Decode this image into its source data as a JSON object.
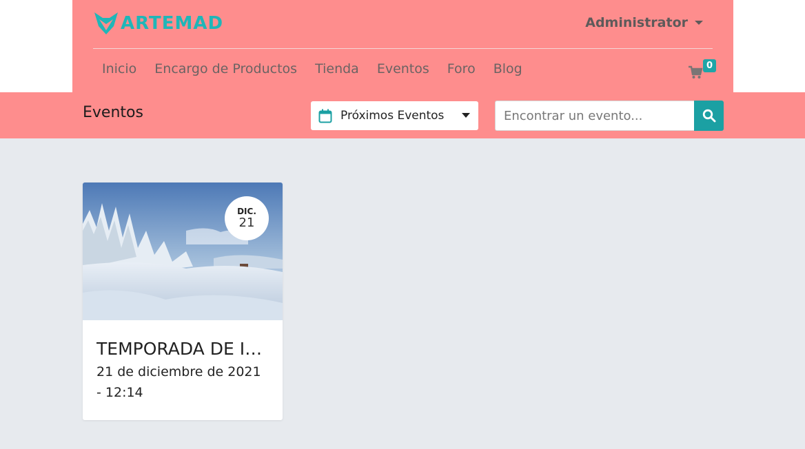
{
  "brand": {
    "name": "ARTEMAD",
    "color": "#1fb6b8"
  },
  "header": {
    "user": "Administrator",
    "nav": [
      "Inicio",
      "Encargo de Productos",
      "Tienda",
      "Eventos",
      "Foro",
      "Blog"
    ],
    "cart_count": "0",
    "cart_icon": "shopping-cart-icon",
    "background": "#fe8d8d"
  },
  "subheader": {
    "title": "Eventos",
    "filter": {
      "icon": "calendar-icon",
      "selected": "Próximos Eventos"
    },
    "search": {
      "placeholder": "Encontrar un evento...",
      "value": "",
      "icon": "search-icon"
    }
  },
  "events": [
    {
      "month": "DIC.",
      "day": "21",
      "title": "TEMPORADA DE INVIERNO",
      "datetime": "21 de diciembre de 2021 - 12:14"
    }
  ]
}
